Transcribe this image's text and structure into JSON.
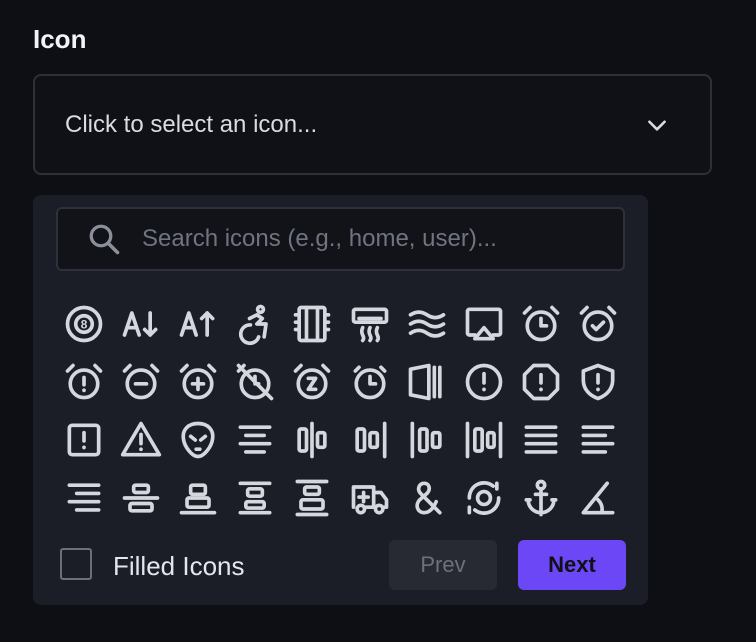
{
  "field": {
    "label": "Icon"
  },
  "select": {
    "placeholder": "Click to select an icon...",
    "icon": "chevron-down-icon"
  },
  "search": {
    "placeholder": "Search icons (e.g., home, user)...",
    "value": "",
    "icon": "search-icon"
  },
  "icons": [
    "8ball",
    "sort-ascending-letters",
    "sort-descending-letters",
    "accessible",
    "accordion",
    "air-conditioning",
    "air-wave",
    "airplay",
    "alarm",
    "alarm-check",
    "alarm-exclamation",
    "alarm-minus",
    "alarm-plus",
    "alarm-off",
    "alarm-snooze",
    "alarm-clock",
    "album",
    "alert-circle",
    "alert-octagon",
    "alert-shield",
    "alert-square",
    "alert-triangle",
    "alien",
    "align-center",
    "align-h-center",
    "align-v-distribute",
    "align-left-bars",
    "align-right-bars",
    "align-justified",
    "align-left",
    "align-right",
    "align-box-center-middle",
    "align-box-bottom-center",
    "align-box-top-center",
    "align-box-middle",
    "ambulance",
    "ampersand",
    "analyze",
    "anchor",
    "angle"
  ],
  "footer": {
    "filled_label": "Filled Icons",
    "filled_checked": false,
    "prev_label": "Prev",
    "next_label": "Next"
  },
  "colors": {
    "accent": "#6b47f5",
    "background": "#0d0f14",
    "panel": "#1b1e26"
  }
}
